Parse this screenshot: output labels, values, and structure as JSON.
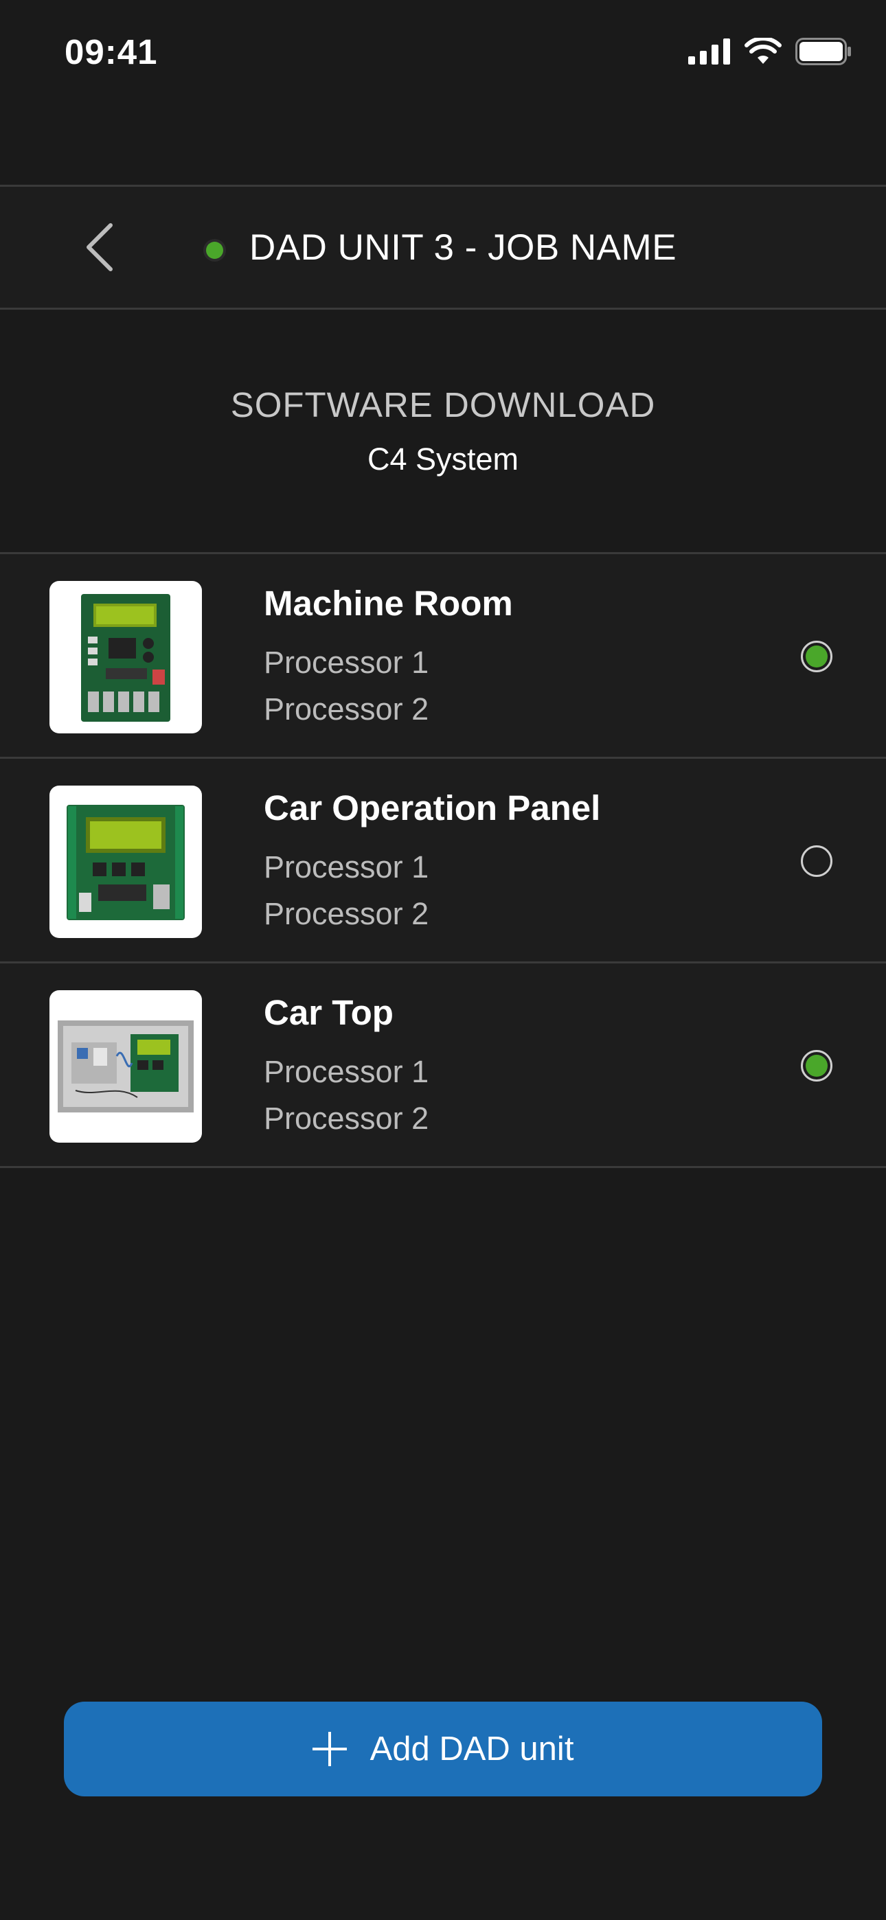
{
  "status_bar": {
    "time": "09:41",
    "icons": [
      "cellular-signal-icon",
      "wifi-icon",
      "battery-icon"
    ]
  },
  "header": {
    "back_icon": "chevron-left-icon",
    "status_color": "#4aa72a",
    "title": "DAD UNIT 3 - JOB NAME"
  },
  "section": {
    "title": "SOFTWARE DOWNLOAD",
    "subtitle": "C4 System"
  },
  "devices": [
    {
      "name": "Machine Room",
      "lines": [
        "Processor 1",
        "Processor 2"
      ],
      "selected": true,
      "image_icon": "circuit-board-image"
    },
    {
      "name": "Car Operation Panel",
      "lines": [
        "Processor 1",
        "Processor 2"
      ],
      "selected": false,
      "image_icon": "circuit-board-image"
    },
    {
      "name": "Car Top",
      "lines": [
        "Processor 1",
        "Processor 2"
      ],
      "selected": true,
      "image_icon": "control-box-image"
    }
  ],
  "add_button": {
    "icon": "plus-icon",
    "label": "Add DAD unit"
  },
  "colors": {
    "background": "#1a1a1a",
    "accent_green": "#4aa72a",
    "button_blue": "#1d70b8"
  }
}
